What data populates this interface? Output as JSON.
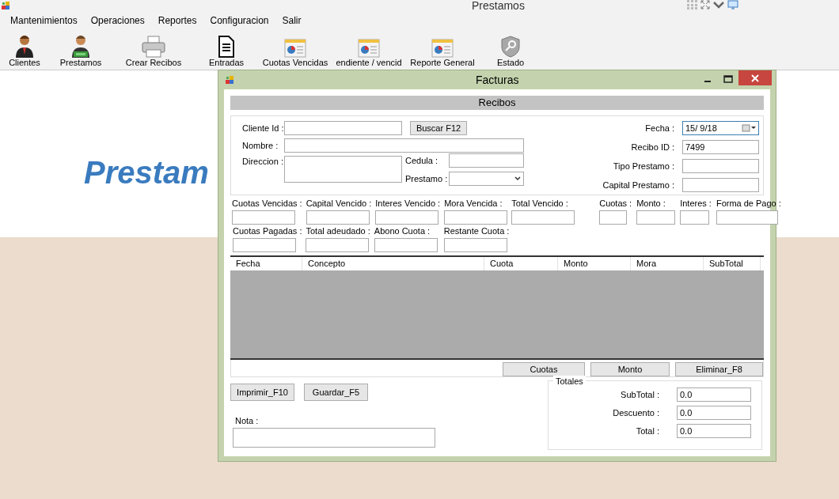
{
  "window": {
    "title": "Prestamos"
  },
  "menu": [
    "Mantenimientos",
    "Operaciones",
    "Reportes",
    "Configuracion",
    "Salir"
  ],
  "toolbar": [
    {
      "label": "Clientes",
      "kind": "person"
    },
    {
      "label": "Prestamos",
      "kind": "person-money"
    },
    {
      "label": "Crear Recibos",
      "kind": "printer"
    },
    {
      "label": "Entradas",
      "kind": "document"
    },
    {
      "label": "Cuotas Vencidas",
      "kind": "report"
    },
    {
      "label": "endiente / vencid",
      "kind": "report"
    },
    {
      "label": "Reporte General",
      "kind": "report"
    },
    {
      "label": "Estado",
      "kind": "shield"
    }
  ],
  "background": {
    "headline": "Prestam"
  },
  "dialog": {
    "title": "Facturas",
    "header": "Recibos",
    "client": {
      "cliente_id": {
        "label": "Cliente Id :"
      },
      "search_button": "Buscar  F12",
      "nombre": {
        "label": "Nombre :"
      },
      "direccion": {
        "label": "Direccion :"
      },
      "cedula": {
        "label": "Cedula  :"
      },
      "prestamo": {
        "label": "Prestamo :"
      }
    },
    "receipt": [
      {
        "label": "Fecha :",
        "kind": "date",
        "value": "15/ 9/18"
      },
      {
        "label": "Recibo ID :",
        "kind": "text",
        "value": "7499"
      },
      {
        "label": "Tipo Prestamo :",
        "kind": "text"
      },
      {
        "label": "Capital Prestamo :",
        "kind": "text"
      }
    ],
    "summary_row_1": [
      {
        "label": "Cuotas Vencidas :"
      },
      {
        "label": "Capital Vencido :"
      },
      {
        "label": "Interes Vencido :"
      },
      {
        "label": "Mora Vencida :"
      },
      {
        "label": "Total Vencido :"
      }
    ],
    "summary_row_1_right": [
      {
        "label": "Cuotas :"
      },
      {
        "label": "Monto :"
      },
      {
        "label": "Interes :"
      },
      {
        "label": "Forma de Pago :"
      }
    ],
    "summary_row_2": [
      {
        "label": "Cuotas Pagadas :"
      },
      {
        "label": "Total adeudado :"
      },
      {
        "label": "Abono Cuota :"
      },
      {
        "label": "Restante Cuota :"
      }
    ],
    "table": {
      "columns": [
        "Fecha",
        "Concepto",
        "Cuota",
        "Monto",
        "Mora",
        "SubTotal"
      ]
    },
    "table_buttons": [
      "Cuotas",
      "Monto",
      "Eliminar_F8"
    ],
    "action_buttons": [
      "Imprimir_F10",
      "Guardar_F5"
    ],
    "nota": {
      "label": "Nota :"
    },
    "totals": {
      "title": "Totales",
      "rows": [
        {
          "label": "SubTotal :",
          "value": "0.0"
        },
        {
          "label": "Descuento :",
          "value": "0.0"
        },
        {
          "label": "Total :",
          "value": "0.0"
        }
      ]
    }
  }
}
